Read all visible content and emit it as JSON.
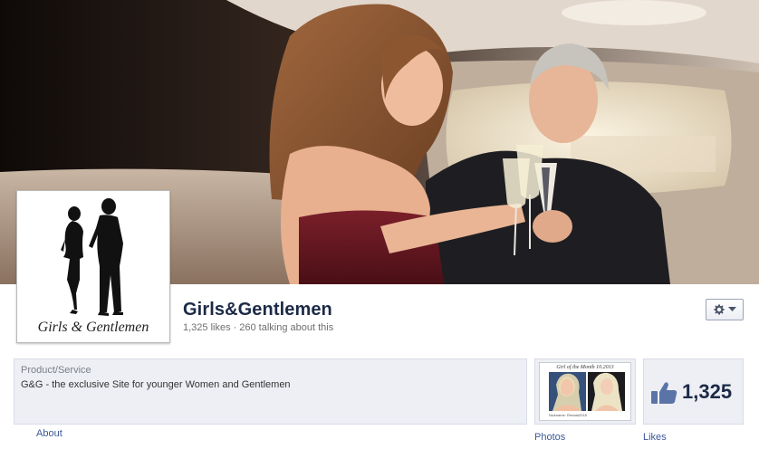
{
  "page": {
    "name": "Girls&Gentlemen",
    "likes_text": "1,325 likes",
    "dot": "·",
    "talking_text": "260 talking about this",
    "logo_text": "Girls & Gentlemen"
  },
  "info": {
    "category": "Product/Service",
    "description": "G&G - the exclusive Site for younger Women and Gentlemen"
  },
  "nav": {
    "about_label": "About",
    "photos_label": "Photos",
    "likes_label": "Likes"
  },
  "photos_tile": {
    "caption": "Girl of the Month 10.2013",
    "sub": "Nickname: Renata2018"
  },
  "likes_tile": {
    "count": "1,325"
  },
  "colors": {
    "title": "#1c2a47",
    "link": "#3b5998",
    "panel": "#edeff4"
  },
  "icons": {
    "gear": "gear-icon",
    "dropdown": "chevron-down-icon",
    "like": "thumbs-up-icon"
  }
}
